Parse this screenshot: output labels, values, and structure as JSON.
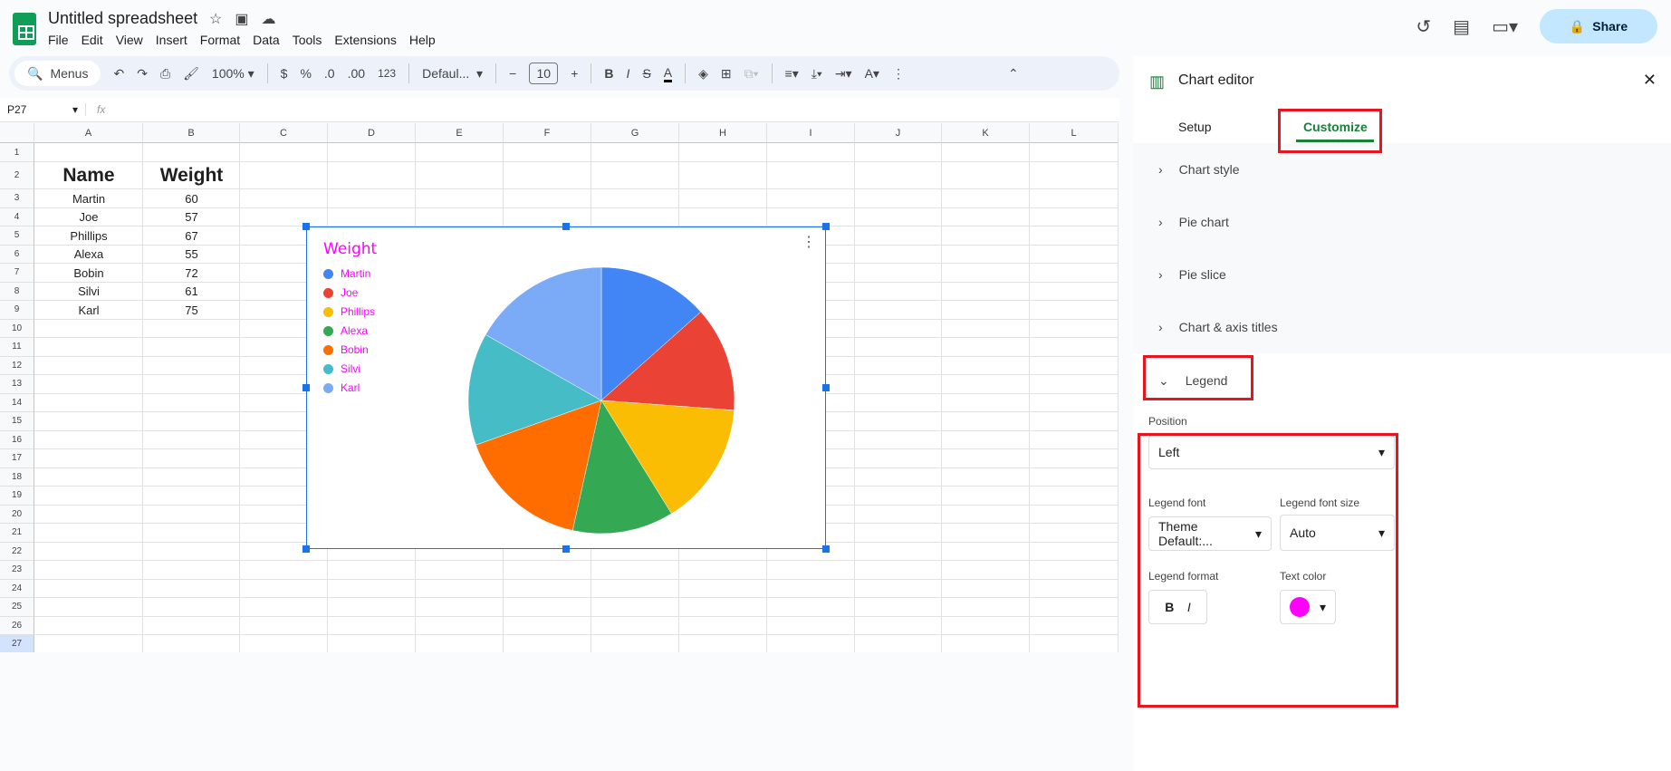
{
  "app": {
    "title": "Untitled spreadsheet",
    "menu": [
      "File",
      "Edit",
      "View",
      "Insert",
      "Format",
      "Data",
      "Tools",
      "Extensions",
      "Help"
    ],
    "share": "Share"
  },
  "toolbar": {
    "menus": "Menus",
    "zoom": "100%",
    "currency": "$",
    "percent": "%",
    "dec_less": ".0",
    "dec_more": ".00",
    "format_num": "123",
    "font": "Defaul...",
    "font_size": "10",
    "bold": "B",
    "italic": "I"
  },
  "formula_bar": {
    "cell_ref": "P27",
    "fx": "fx"
  },
  "columns": [
    "A",
    "B",
    "C",
    "D",
    "E",
    "F",
    "G",
    "H",
    "I",
    "J",
    "K",
    "L"
  ],
  "rows": [
    "1",
    "2",
    "3",
    "4",
    "5",
    "6",
    "7",
    "8",
    "9",
    "10",
    "11",
    "12",
    "13",
    "14",
    "15",
    "16",
    "17",
    "18",
    "19",
    "20",
    "21",
    "22",
    "23",
    "24",
    "25",
    "26",
    "27"
  ],
  "table": {
    "headers": [
      "Name",
      "Weight"
    ],
    "rows": [
      [
        "Martin",
        "60"
      ],
      [
        "Joe",
        "57"
      ],
      [
        "Phillips",
        "67"
      ],
      [
        "Alexa",
        "55"
      ],
      [
        "Bobin",
        "72"
      ],
      [
        "Silvi",
        "61"
      ],
      [
        "Karl",
        "75"
      ]
    ]
  },
  "chart_data": {
    "type": "pie",
    "title": "Weight",
    "legend_position": "left",
    "legend_text_color": "#ff00ff",
    "categories": [
      "Martin",
      "Joe",
      "Phillips",
      "Alexa",
      "Bobin",
      "Silvi",
      "Karl"
    ],
    "values": [
      60,
      57,
      67,
      55,
      72,
      61,
      75
    ],
    "colors": [
      "#4285f4",
      "#ea4335",
      "#fbbc04",
      "#34a853",
      "#ff6d01",
      "#46bdc6",
      "#7baaf7"
    ]
  },
  "editor": {
    "title": "Chart editor",
    "tabs": [
      "Setup",
      "Customize"
    ],
    "active_tab": "Customize",
    "sections": [
      "Chart style",
      "Pie chart",
      "Pie slice",
      "Chart & axis titles"
    ],
    "legend": {
      "heading": "Legend",
      "position_label": "Position",
      "position": "Left",
      "font_label": "Legend font",
      "font": "Theme Default:...",
      "font_size_label": "Legend font size",
      "font_size": "Auto",
      "format_label": "Legend format",
      "bold": "B",
      "italic": "I",
      "color_label": "Text color",
      "text_color": "#ff00ff"
    }
  },
  "annotation_color": "#e8141e"
}
